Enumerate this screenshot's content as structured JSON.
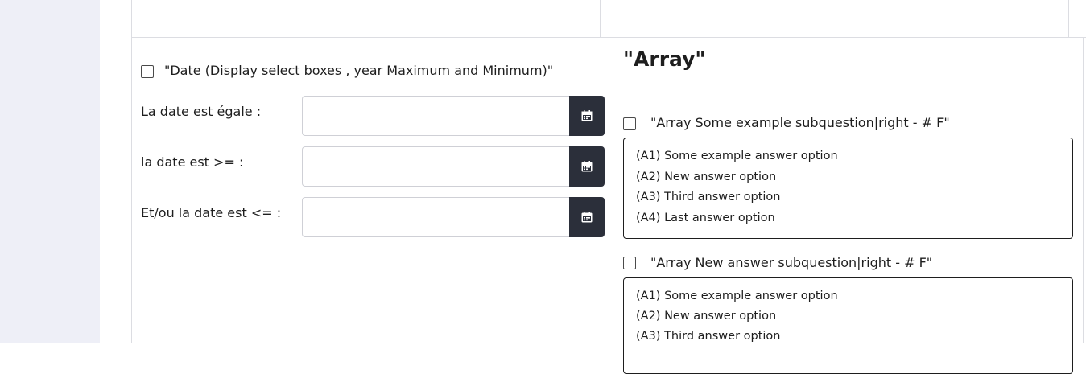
{
  "date_filter": {
    "label": "\"Date (Display select boxes , year Maximum and Minimum)\"",
    "rows": [
      {
        "label": "La date est égale :"
      },
      {
        "label": "la date est >= :"
      },
      {
        "label": "Et/ou la date est <= :"
      }
    ]
  },
  "array": {
    "title": "\"Array\"",
    "subquestions": [
      {
        "label": "\"Array Some example subquestion|right - # F\"",
        "options": [
          "(A1) Some example answer option",
          "(A2) New answer option",
          "(A3) Third answer option",
          "(A4) Last answer option"
        ]
      },
      {
        "label": "\"Array New answer subquestion|right - # F\"",
        "options": [
          "(A1) Some example answer option",
          "(A2) New answer option",
          "(A3) Third answer option"
        ]
      }
    ]
  },
  "icons": {
    "calendar": "calendar-icon"
  },
  "colors": {
    "sidebar_bg": "#eeeff7",
    "button_bg": "#2b2f3a",
    "border": "#dcdde2"
  }
}
